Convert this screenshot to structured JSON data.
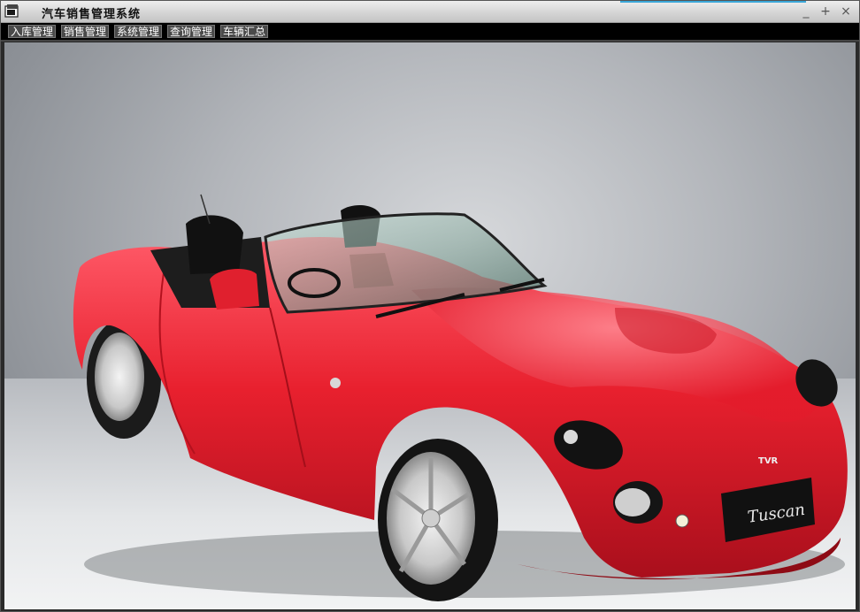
{
  "window": {
    "title": "汽车销售管理系统",
    "accent_color": "#3aa7d8"
  },
  "controls": {
    "minimize": "_",
    "maximize": "+",
    "close": "×"
  },
  "menu": {
    "items": [
      {
        "label": "入库管理"
      },
      {
        "label": "销售管理"
      },
      {
        "label": "系统管理"
      },
      {
        "label": "查询管理"
      },
      {
        "label": "车辆汇总"
      }
    ]
  },
  "content": {
    "image": "red-convertible-sports-car",
    "plate_text": "Tuscan",
    "badge_text": "TVR"
  },
  "colors": {
    "car_body": "#e8202e",
    "menubar_bg": "#000000"
  }
}
